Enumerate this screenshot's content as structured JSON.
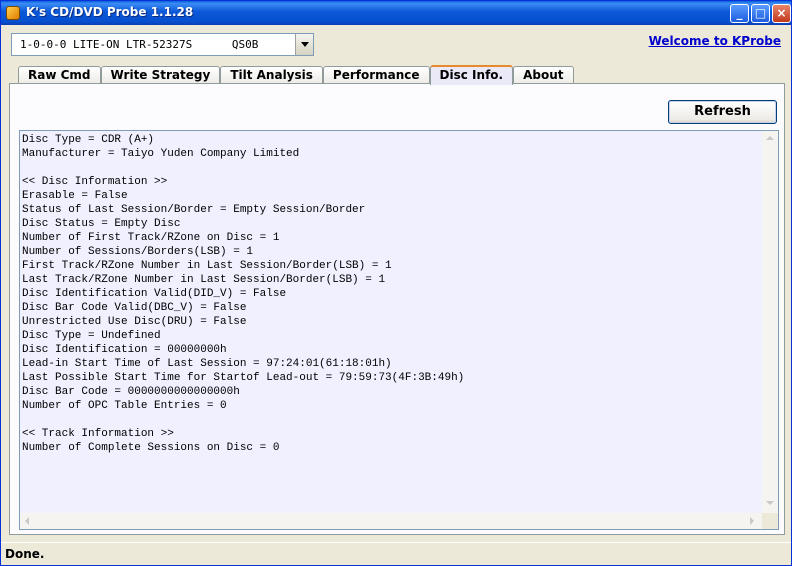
{
  "window": {
    "title": "K's CD/DVD Probe 1.1.28",
    "minimize_glyph": "_",
    "maximize_glyph": "□",
    "close_glyph": "×"
  },
  "drive_select": {
    "value": "1-0-0-0 LITE-ON LTR-52327S      QS0B"
  },
  "welcome_link": "Welcome to KProbe",
  "tabs": [
    {
      "label": "Raw Cmd",
      "active": false
    },
    {
      "label": "Write Strategy",
      "active": false
    },
    {
      "label": "Tilt Analysis",
      "active": false
    },
    {
      "label": "Performance",
      "active": false
    },
    {
      "label": "Disc Info.",
      "active": true
    },
    {
      "label": "About",
      "active": false
    }
  ],
  "refresh_label": "Refresh",
  "disc_info_lines": [
    "Disc Type = CDR (A+)",
    "Manufacturer = Taiyo Yuden Company Limited",
    "",
    "<< Disc Information >>",
    "Erasable = False",
    "Status of Last Session/Border = Empty Session/Border",
    "Disc Status = Empty Disc",
    "Number of First Track/RZone on Disc = 1",
    "Number of Sessions/Borders(LSB) = 1",
    "First Track/RZone Number in Last Session/Border(LSB) = 1",
    "Last Track/RZone Number in Last Session/Border(LSB) = 1",
    "Disc Identification Valid(DID_V) = False",
    "Disc Bar Code Valid(DBC_V) = False",
    "Unrestricted Use Disc(DRU) = False",
    "Disc Type = Undefined",
    "Disc Identification = 00000000h",
    "Lead-in Start Time of Last Session = 97:24:01(61:18:01h)",
    "Last Possible Start Time for Startof Lead-out = 79:59:73(4F:3B:49h)",
    "Disc Bar Code = 0000000000000000h",
    "Number of OPC Table Entries = 0",
    "",
    "<< Track Information >>",
    "Number of Complete Sessions on Disc = 0"
  ],
  "status": "Done."
}
